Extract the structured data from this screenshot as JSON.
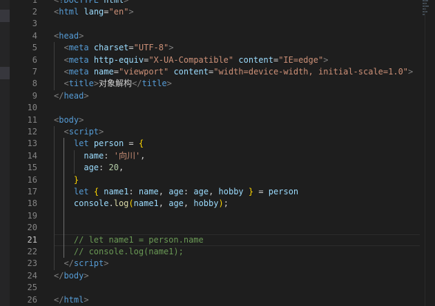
{
  "editor": {
    "current_line": 21,
    "lines": [
      {
        "n": "1",
        "tokens": [
          {
            "c": "punc",
            "t": "<"
          },
          {
            "c": "tag",
            "t": "!DOCTYPE"
          },
          {
            "c": "txt",
            "t": " "
          },
          {
            "c": "attr",
            "t": "html"
          },
          {
            "c": "punc",
            "t": ">"
          }
        ]
      },
      {
        "n": "2",
        "tokens": [
          {
            "c": "punc",
            "t": "<"
          },
          {
            "c": "tag",
            "t": "html"
          },
          {
            "c": "txt",
            "t": " "
          },
          {
            "c": "attr",
            "t": "lang"
          },
          {
            "c": "txt",
            "t": "="
          },
          {
            "c": "str",
            "t": "\"en\""
          },
          {
            "c": "punc",
            "t": ">"
          }
        ]
      },
      {
        "n": "3",
        "tokens": []
      },
      {
        "n": "4",
        "tokens": [
          {
            "c": "punc",
            "t": "<"
          },
          {
            "c": "tag",
            "t": "head"
          },
          {
            "c": "punc",
            "t": ">"
          }
        ]
      },
      {
        "n": "5",
        "tokens": [
          {
            "c": "txt",
            "t": "  "
          },
          {
            "c": "punc",
            "t": "<"
          },
          {
            "c": "tag",
            "t": "meta"
          },
          {
            "c": "txt",
            "t": " "
          },
          {
            "c": "attr",
            "t": "charset"
          },
          {
            "c": "txt",
            "t": "="
          },
          {
            "c": "str",
            "t": "\"UTF-8\""
          },
          {
            "c": "punc",
            "t": ">"
          }
        ]
      },
      {
        "n": "6",
        "tokens": [
          {
            "c": "txt",
            "t": "  "
          },
          {
            "c": "punc",
            "t": "<"
          },
          {
            "c": "tag",
            "t": "meta"
          },
          {
            "c": "txt",
            "t": " "
          },
          {
            "c": "attr",
            "t": "http-equiv"
          },
          {
            "c": "txt",
            "t": "="
          },
          {
            "c": "str",
            "t": "\"X-UA-Compatible\""
          },
          {
            "c": "txt",
            "t": " "
          },
          {
            "c": "attr",
            "t": "content"
          },
          {
            "c": "txt",
            "t": "="
          },
          {
            "c": "str",
            "t": "\"IE=edge\""
          },
          {
            "c": "punc",
            "t": ">"
          }
        ]
      },
      {
        "n": "7",
        "tokens": [
          {
            "c": "txt",
            "t": "  "
          },
          {
            "c": "punc",
            "t": "<"
          },
          {
            "c": "tag",
            "t": "meta"
          },
          {
            "c": "txt",
            "t": " "
          },
          {
            "c": "attr",
            "t": "name"
          },
          {
            "c": "txt",
            "t": "="
          },
          {
            "c": "str",
            "t": "\"viewport\""
          },
          {
            "c": "txt",
            "t": " "
          },
          {
            "c": "attr",
            "t": "content"
          },
          {
            "c": "txt",
            "t": "="
          },
          {
            "c": "str",
            "t": "\"width=device-width, initial-scale=1.0\""
          },
          {
            "c": "punc",
            "t": ">"
          }
        ]
      },
      {
        "n": "8",
        "tokens": [
          {
            "c": "txt",
            "t": "  "
          },
          {
            "c": "punc",
            "t": "<"
          },
          {
            "c": "tag",
            "t": "title"
          },
          {
            "c": "punc",
            "t": ">"
          },
          {
            "c": "txt",
            "t": "对象解构"
          },
          {
            "c": "punc",
            "t": "</"
          },
          {
            "c": "tag",
            "t": "title"
          },
          {
            "c": "punc",
            "t": ">"
          }
        ]
      },
      {
        "n": "9",
        "tokens": [
          {
            "c": "punc",
            "t": "</"
          },
          {
            "c": "tag",
            "t": "head"
          },
          {
            "c": "punc",
            "t": ">"
          }
        ]
      },
      {
        "n": "10",
        "tokens": []
      },
      {
        "n": "11",
        "tokens": [
          {
            "c": "punc",
            "t": "<"
          },
          {
            "c": "tag",
            "t": "body"
          },
          {
            "c": "punc",
            "t": ">"
          }
        ]
      },
      {
        "n": "12",
        "tokens": [
          {
            "c": "txt",
            "t": "  "
          },
          {
            "c": "punc",
            "t": "<"
          },
          {
            "c": "tag",
            "t": "script"
          },
          {
            "c": "punc",
            "t": ">"
          }
        ]
      },
      {
        "n": "13",
        "tokens": [
          {
            "c": "txt",
            "t": "    "
          },
          {
            "c": "kw",
            "t": "let"
          },
          {
            "c": "txt",
            "t": " "
          },
          {
            "c": "var",
            "t": "person"
          },
          {
            "c": "txt",
            "t": " = "
          },
          {
            "c": "br1",
            "t": "{"
          }
        ]
      },
      {
        "n": "14",
        "tokens": [
          {
            "c": "txt",
            "t": "      "
          },
          {
            "c": "var",
            "t": "name"
          },
          {
            "c": "txt",
            "t": ": "
          },
          {
            "c": "str",
            "t": "'向川'"
          },
          {
            "c": "txt",
            "t": ","
          }
        ]
      },
      {
        "n": "15",
        "tokens": [
          {
            "c": "txt",
            "t": "      "
          },
          {
            "c": "var",
            "t": "age"
          },
          {
            "c": "txt",
            "t": ": "
          },
          {
            "c": "num",
            "t": "20"
          },
          {
            "c": "txt",
            "t": ","
          }
        ]
      },
      {
        "n": "16",
        "tokens": [
          {
            "c": "txt",
            "t": "    "
          },
          {
            "c": "br1",
            "t": "}"
          }
        ]
      },
      {
        "n": "17",
        "tokens": [
          {
            "c": "txt",
            "t": "    "
          },
          {
            "c": "kw",
            "t": "let"
          },
          {
            "c": "txt",
            "t": " "
          },
          {
            "c": "br1",
            "t": "{"
          },
          {
            "c": "txt",
            "t": " "
          },
          {
            "c": "var",
            "t": "name1"
          },
          {
            "c": "txt",
            "t": ": "
          },
          {
            "c": "var",
            "t": "name"
          },
          {
            "c": "txt",
            "t": ", "
          },
          {
            "c": "var",
            "t": "age"
          },
          {
            "c": "txt",
            "t": ": "
          },
          {
            "c": "var",
            "t": "age"
          },
          {
            "c": "txt",
            "t": ", "
          },
          {
            "c": "var",
            "t": "hobby"
          },
          {
            "c": "txt",
            "t": " "
          },
          {
            "c": "br1",
            "t": "}"
          },
          {
            "c": "txt",
            "t": " = "
          },
          {
            "c": "var",
            "t": "person"
          }
        ]
      },
      {
        "n": "18",
        "tokens": [
          {
            "c": "txt",
            "t": "    "
          },
          {
            "c": "var",
            "t": "console"
          },
          {
            "c": "txt",
            "t": "."
          },
          {
            "c": "fn",
            "t": "log"
          },
          {
            "c": "br1",
            "t": "("
          },
          {
            "c": "var",
            "t": "name1"
          },
          {
            "c": "txt",
            "t": ", "
          },
          {
            "c": "var",
            "t": "age"
          },
          {
            "c": "txt",
            "t": ", "
          },
          {
            "c": "var",
            "t": "hobby"
          },
          {
            "c": "br1",
            "t": ")"
          },
          {
            "c": "txt",
            "t": ";"
          }
        ]
      },
      {
        "n": "19",
        "tokens": []
      },
      {
        "n": "20",
        "tokens": []
      },
      {
        "n": "21",
        "tokens": [
          {
            "c": "txt",
            "t": "    "
          },
          {
            "c": "cmt",
            "t": "// let name1 = person.name"
          }
        ]
      },
      {
        "n": "22",
        "tokens": [
          {
            "c": "txt",
            "t": "    "
          },
          {
            "c": "cmt",
            "t": "// console.log(name1);"
          }
        ]
      },
      {
        "n": "23",
        "tokens": [
          {
            "c": "txt",
            "t": "  "
          },
          {
            "c": "punc",
            "t": "</"
          },
          {
            "c": "tag",
            "t": "script"
          },
          {
            "c": "punc",
            "t": ">"
          }
        ]
      },
      {
        "n": "24",
        "tokens": [
          {
            "c": "punc",
            "t": "</"
          },
          {
            "c": "tag",
            "t": "body"
          },
          {
            "c": "punc",
            "t": ">"
          }
        ]
      },
      {
        "n": "25",
        "tokens": []
      },
      {
        "n": "26",
        "tokens": [
          {
            "c": "punc",
            "t": "</"
          },
          {
            "c": "tag",
            "t": "html"
          },
          {
            "c": "punc",
            "t": ">"
          }
        ]
      }
    ]
  }
}
